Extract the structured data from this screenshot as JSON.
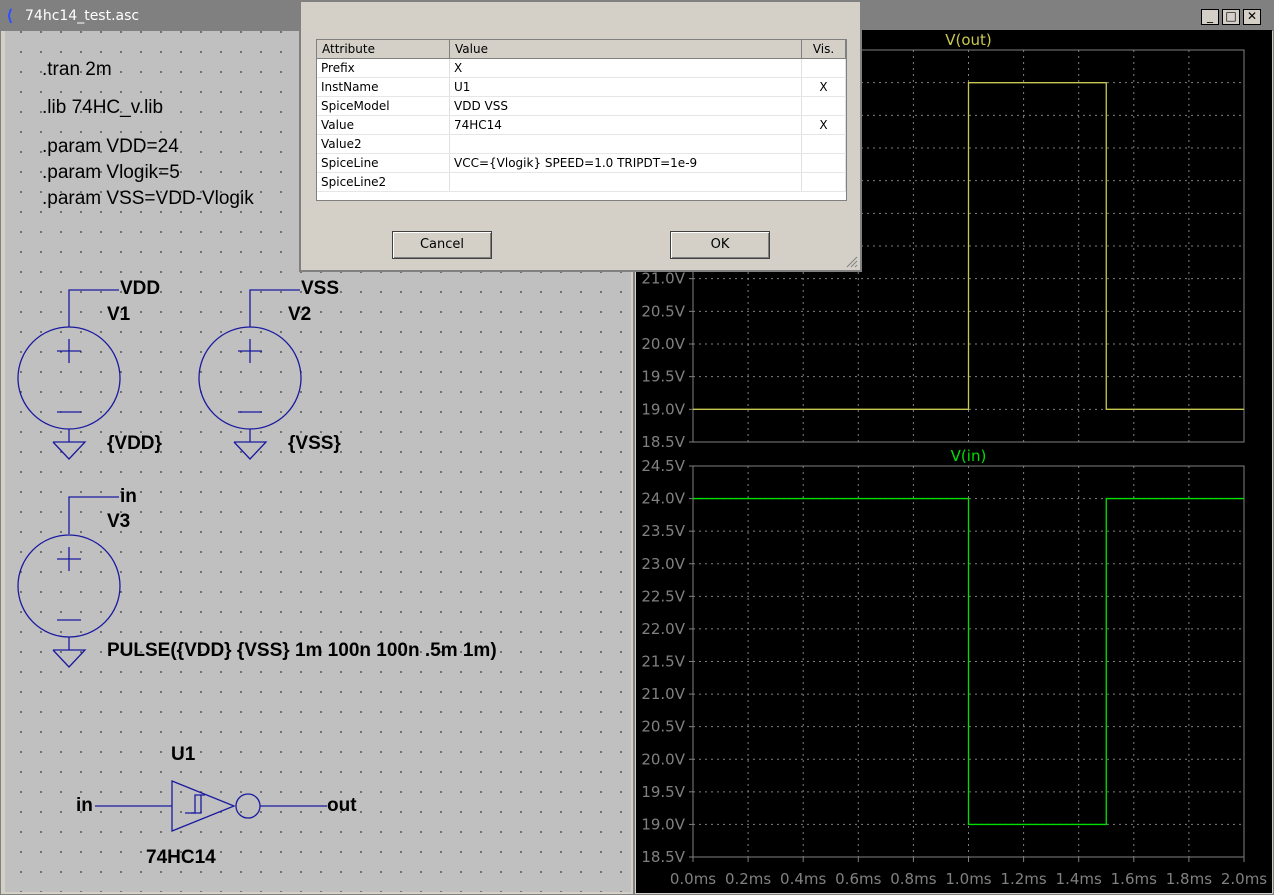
{
  "schematic": {
    "title": "74hc14_test.asc",
    "directives": [
      ".tran 2m",
      ".lib 74HC_v.lib",
      ".param VDD=24",
      ".param Vlogik=5",
      ".param VSS=VDD-Vlogik"
    ],
    "v1": {
      "net": "VDD",
      "name": "V1",
      "value": "{VDD}"
    },
    "v2": {
      "net": "VSS",
      "name": "V2",
      "value": "{VSS}"
    },
    "v3": {
      "net": "in",
      "name": "V3",
      "value": "PULSE({VDD} {VSS} 1m 100n 100n .5m 1m)"
    },
    "u1": {
      "name": "U1",
      "model": "74HC14",
      "in_label": "in",
      "out_label": "out"
    }
  },
  "plot_window": {
    "minimize": "_",
    "maximize": "□",
    "close": "✕"
  },
  "dialog": {
    "headers": {
      "attribute": "Attribute",
      "value": "Value",
      "vis": "Vis."
    },
    "rows": [
      {
        "attr": "Prefix",
        "value": "X",
        "vis": ""
      },
      {
        "attr": "InstName",
        "value": "U1",
        "vis": "X"
      },
      {
        "attr": "SpiceModel",
        "value": "VDD VSS",
        "vis": ""
      },
      {
        "attr": "Value",
        "value": "74HC14",
        "vis": "X"
      },
      {
        "attr": "Value2",
        "value": "",
        "vis": ""
      },
      {
        "attr": "SpiceLine",
        "value": "VCC={Vlogik}  SPEED=1.0  TRIPDT=1e-9",
        "vis": ""
      },
      {
        "attr": "SpiceLine2",
        "value": "",
        "vis": ""
      }
    ],
    "cancel_label": "Cancel",
    "ok_label": "OK"
  },
  "chart_data": [
    {
      "type": "line",
      "series": [
        {
          "name": "V(out)",
          "color": "#c8c850",
          "x": [
            0.0,
            1.0,
            1.0,
            1.5,
            1.5,
            2.0
          ],
          "values": [
            19.0,
            19.0,
            24.0,
            24.0,
            19.0,
            19.0
          ]
        }
      ],
      "x_tick_labels": [
        "0.0ms",
        "0.2ms",
        "0.4ms",
        "0.6ms",
        "0.8ms",
        "1.0ms",
        "1.2ms",
        "1.4ms",
        "1.6ms",
        "1.8ms",
        "2.0ms"
      ],
      "y_tick_labels_visible": [
        "21.0V",
        "20.5V",
        "20.0V",
        "19.5V",
        "19.0V",
        "18.5V"
      ],
      "xlim": [
        0,
        2
      ],
      "ylim": [
        18.5,
        24.5
      ],
      "grid": true
    },
    {
      "type": "line",
      "series": [
        {
          "name": "V(in)",
          "color": "#00e000",
          "x": [
            0.0,
            1.0,
            1.0,
            1.5,
            1.5,
            2.0
          ],
          "values": [
            24.0,
            24.0,
            19.0,
            19.0,
            24.0,
            24.0
          ]
        }
      ],
      "y_tick_labels": [
        "24.5V",
        "24.0V",
        "23.5V",
        "23.0V",
        "22.5V",
        "22.0V",
        "21.5V",
        "21.0V",
        "20.5V",
        "20.0V",
        "19.5V",
        "19.0V",
        "18.5V"
      ],
      "xlim": [
        0,
        2
      ],
      "ylim": [
        18.5,
        24.5
      ],
      "grid": true
    }
  ]
}
